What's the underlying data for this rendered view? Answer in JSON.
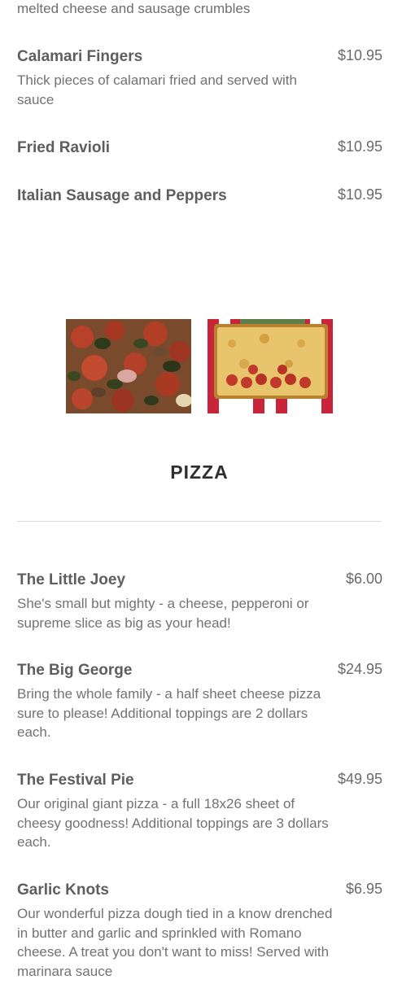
{
  "appetizers": {
    "cut_description": "melted cheese and sausage crumbles",
    "items": [
      {
        "name": "Calamari Fingers",
        "price": "$10.95",
        "description": "Thick pieces of calamari fried and served with sauce"
      },
      {
        "name": "Fried Ravioli",
        "price": "$10.95",
        "description": ""
      },
      {
        "name": "Italian Sausage and Peppers",
        "price": "$10.95",
        "description": ""
      }
    ]
  },
  "photos": [
    {
      "icon": "pizza-photo-supreme"
    },
    {
      "icon": "pizza-photo-sheet-pepperoni"
    }
  ],
  "pizza": {
    "title": "PIZZA",
    "items": [
      {
        "name": "The Little Joey",
        "price": "$6.00",
        "description": "She's small but mighty - a cheese, pepperoni or supreme slice as big as your head!"
      },
      {
        "name": "The Big George",
        "price": "$24.95",
        "description": "Bring the whole family - a half sheet cheese pizza sure to please! Additional toppings are 2 dollars each."
      },
      {
        "name": "The Festival Pie",
        "price": "$49.95",
        "description": "Our original giant pizza - a full 18x26 sheet of cheesy goodness! Additional toppings are 3 dollars each."
      },
      {
        "name": "Garlic Knots",
        "price": "$6.95",
        "description": "Our wonderful pizza dough tied in a know drenched in butter and garlic and sprinkled with Romano cheese. A treat you don't want to miss! Served with marinara sauce"
      }
    ]
  }
}
